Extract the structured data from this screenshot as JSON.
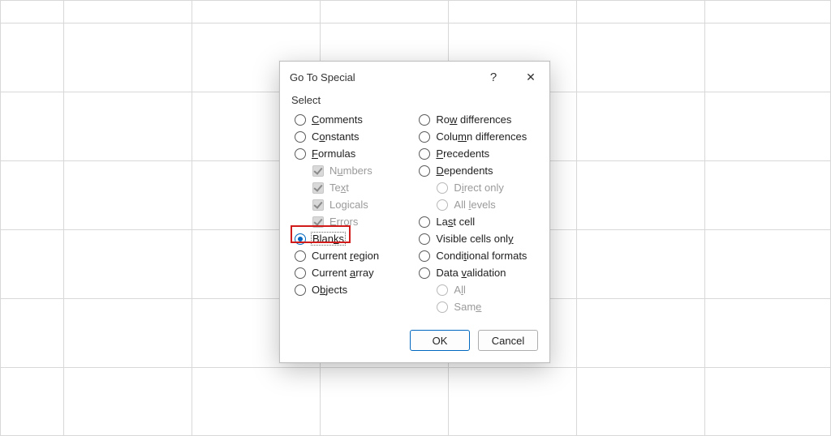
{
  "dialog": {
    "title": "Go To Special",
    "help_tooltip": "Help",
    "close_tooltip": "Close",
    "section_label": "Select",
    "left": {
      "comments": "Comments",
      "constants": "Constants",
      "formulas": "Formulas",
      "numbers": "Numbers",
      "text": "Text",
      "logicals": "Logicals",
      "errors": "Errors",
      "blanks": "Blanks",
      "current_region": "Current region",
      "current_array": "Current array",
      "objects": "Objects"
    },
    "right": {
      "row_diff": "Row differences",
      "col_diff": "Column differences",
      "precedents": "Precedents",
      "dependents": "Dependents",
      "direct_only": "Direct only",
      "all_levels": "All levels",
      "last_cell": "Last cell",
      "visible": "Visible cells only",
      "cond_formats": "Conditional formats",
      "data_validation": "Data validation",
      "all": "All",
      "same": "Same"
    },
    "selected_option": "blanks",
    "ok_label": "OK",
    "cancel_label": "Cancel"
  },
  "underlines": {
    "comments": "C",
    "constants": "o",
    "formulas": "F",
    "numbers": "u",
    "text": "x",
    "logicals": "g",
    "errors": "E",
    "blanks": "k",
    "current_region": "r",
    "current_array": "a",
    "objects": "b",
    "row_diff": "w",
    "col_diff": "m",
    "precedents": "P",
    "dependents": "D",
    "direct_only": "I",
    "all_levels": "l",
    "last_cell": "s",
    "visible": "y",
    "cond_formats": "t",
    "data_validation": "v",
    "all": "l",
    "same": "e"
  }
}
